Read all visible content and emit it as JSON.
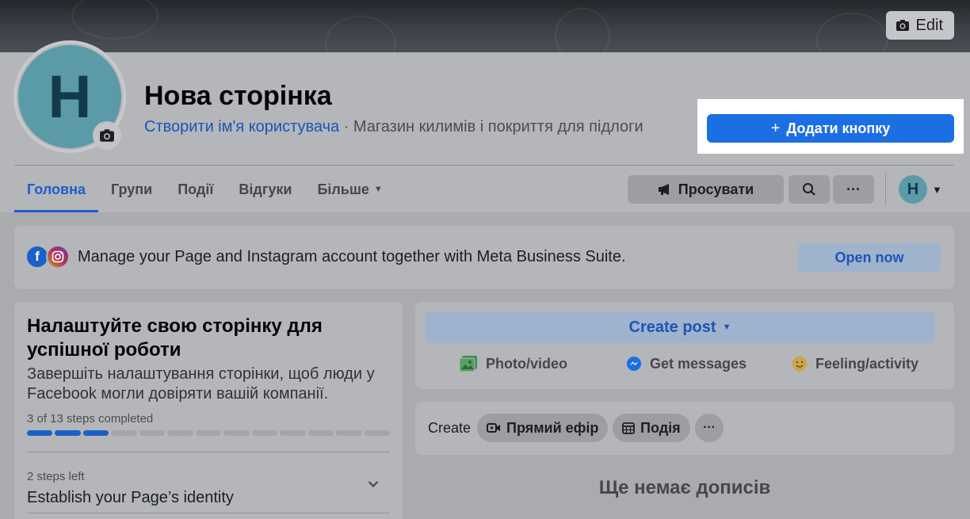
{
  "cover": {
    "edit_label": "Edit"
  },
  "page": {
    "avatar_letter": "H",
    "title": "Нова сторінка",
    "username_link": "Створити ім'я користувача",
    "separator": " · ",
    "category": "Магазин килимів і покриття для підлоги",
    "add_button_label": "Додати кнопку"
  },
  "tabs": [
    {
      "label": "Головна",
      "active": true
    },
    {
      "label": "Групи"
    },
    {
      "label": "Події"
    },
    {
      "label": "Відгуки"
    },
    {
      "label": "Більше"
    }
  ],
  "actions": {
    "promote_label": "Просувати",
    "profile_letter": "H"
  },
  "banner": {
    "text": "Manage your Page and Instagram account together with Meta Business Suite.",
    "open_label": "Open now"
  },
  "setup": {
    "title": "Налаштуйте свою сторінку для успішної роботи",
    "description": "Завершіть налаштування сторінки, щоб люди у Facebook могли довіряти вашій компанії.",
    "progress_label": "3 of 13 steps completed",
    "steps_done": 3,
    "steps_total": 13,
    "steps_left": "2 steps left",
    "section_title": "Establish your Page’s identity"
  },
  "composer": {
    "create_post_label": "Create post",
    "photo_label": "Photo/video",
    "messages_label": "Get messages",
    "feeling_label": "Feeling/activity"
  },
  "create_bar": {
    "label": "Create",
    "live_label": "Прямий ефір",
    "event_label": "Подія"
  },
  "feed": {
    "empty_text": "Ще немає дописів"
  },
  "colors": {
    "accent": "#1b6fe3",
    "link": "#1b55b8",
    "avatar": "#5b9ba8"
  }
}
